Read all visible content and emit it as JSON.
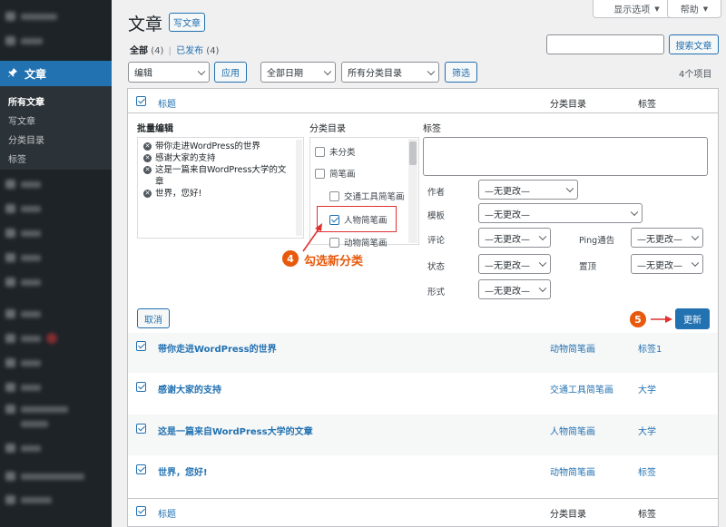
{
  "top_buttons": {
    "screen_options": "显示选项",
    "help": "帮助"
  },
  "header": {
    "title": "文章",
    "add_new": "写文章"
  },
  "views": {
    "all": "全部",
    "all_count": "(4)",
    "sep": "|",
    "published": "已发布",
    "published_count": "(4)"
  },
  "search": {
    "button": "搜索文章",
    "value": ""
  },
  "tablenav": {
    "bulk_action": "编辑",
    "apply": "应用",
    "date_filter": "全部日期",
    "cat_filter": "所有分类目录",
    "filter": "筛选",
    "items": "4个项目"
  },
  "columns": {
    "title": "标题",
    "categories": "分类目录",
    "tags": "标签"
  },
  "sidebar": {
    "posts": "文章",
    "sub": [
      "所有文章",
      "写文章",
      "分类目录",
      "标签"
    ]
  },
  "bulk_edit": {
    "heading": "批量编辑",
    "posts": [
      "带你走进WordPress的世界",
      "感谢大家的支持",
      "这是一篇来自WordPress大学的文章",
      "世界，您好!"
    ],
    "post3_line1": "这是一篇来自WordPress大学的文",
    "post3_line2": "章",
    "cat_heading": "分类目录",
    "categories": [
      "未分类",
      "简笔画",
      "交通工具简笔画",
      "人物简笔画",
      "动物简笔画"
    ],
    "tags_heading": "标签",
    "author_label": "作者",
    "author_value": "—无更改—",
    "template_label": "模板",
    "template_value": "—无更改—",
    "comments_label": "评论",
    "comments_value": "—无更改—",
    "ping_label": "Ping通告",
    "ping_value": "—无更改—",
    "status_label": "状态",
    "status_value": "—无更改—",
    "sticky_label": "置顶",
    "sticky_value": "—无更改—",
    "format_label": "形式",
    "format_value": "—无更改—",
    "cancel": "取消",
    "update": "更新"
  },
  "annotations": {
    "step4_num": "4",
    "step4_text": "勾选新分类",
    "step5_num": "5",
    "accent": "#e8590c"
  },
  "rows": [
    {
      "title": "带你走进WordPress的世界",
      "category": "动物简笔画",
      "tag": "标签1"
    },
    {
      "title": "感谢大家的支持",
      "category": "交通工具简笔画",
      "tag": "大学"
    },
    {
      "title": "这是一篇来自WordPress大学的文章",
      "category": "人物简笔画",
      "tag": "大学"
    },
    {
      "title": "世界，您好!",
      "category": "动物简笔画",
      "tag": "标签"
    }
  ]
}
